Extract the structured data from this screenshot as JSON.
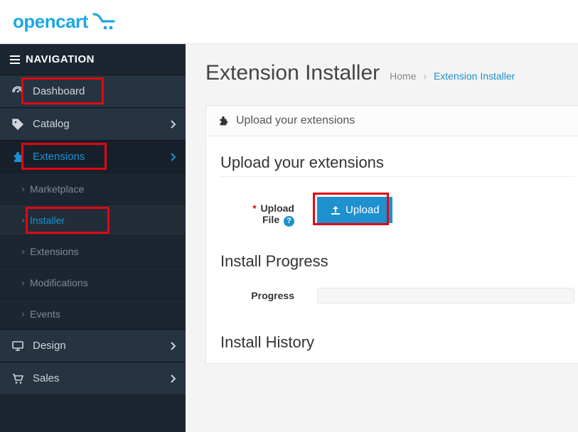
{
  "header": {
    "brand": "opencart"
  },
  "sidebar": {
    "nav_label": "NAVIGATION",
    "dashboard_label": "Dashboard",
    "catalog_label": "Catalog",
    "extensions_label": "Extensions",
    "design_label": "Design",
    "sales_label": "Sales",
    "ext_sub": {
      "marketplace": "Marketplace",
      "installer": "Installer",
      "extensions": "Extensions",
      "modifications": "Modifications",
      "events": "Events"
    }
  },
  "page": {
    "title": "Extension Installer",
    "breadcrumbs": {
      "home": "Home",
      "current": "Extension Installer"
    }
  },
  "panel": {
    "head_label": "Upload your extensions",
    "upload_section_title": "Upload your extensions",
    "upload_label_1": "Upload",
    "upload_label_2": "File",
    "upload_button": "Upload",
    "progress_section_title": "Install Progress",
    "progress_label": "Progress",
    "history_section_title": "Install History"
  }
}
